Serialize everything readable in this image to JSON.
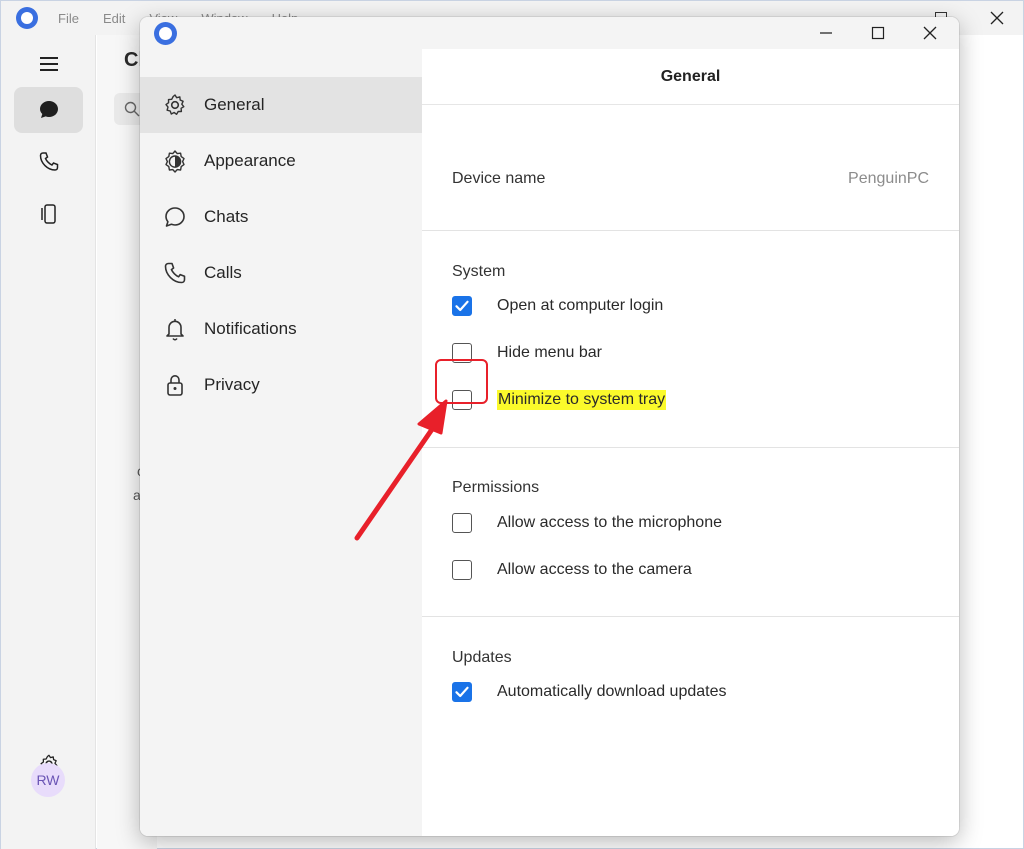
{
  "background_app": {
    "menu": [
      "File",
      "Edit",
      "View",
      "Window",
      "Help"
    ],
    "heading_fragment": "Cl",
    "side_fragments": [
      "c",
      "a"
    ],
    "avatar_initials": "RW",
    "rail_icons": [
      "menu-icon",
      "chat-icon",
      "phone-icon",
      "device-icon",
      "settings-icon"
    ]
  },
  "dialog": {
    "title_bar": {
      "icon": "app-logo-icon",
      "controls": [
        "minimize",
        "maximize",
        "close"
      ]
    },
    "sidebar": {
      "items": [
        {
          "label": "General",
          "icon": "gear-icon",
          "active": true
        },
        {
          "label": "Appearance",
          "icon": "appearance-icon",
          "active": false
        },
        {
          "label": "Chats",
          "icon": "chat-bubble-icon",
          "active": false
        },
        {
          "label": "Calls",
          "icon": "phone-icon",
          "active": false
        },
        {
          "label": "Notifications",
          "icon": "bell-icon",
          "active": false
        },
        {
          "label": "Privacy",
          "icon": "lock-icon",
          "active": false
        }
      ]
    },
    "content": {
      "title": "General",
      "device": {
        "label": "Device name",
        "value": "PenguinPC"
      },
      "system": {
        "title": "System",
        "options": [
          {
            "label": "Open at computer login",
            "checked": true
          },
          {
            "label": "Hide menu bar",
            "checked": false
          },
          {
            "label": "Minimize to system tray",
            "checked": false,
            "highlighted": true
          }
        ]
      },
      "permissions": {
        "title": "Permissions",
        "options": [
          {
            "label": "Allow access to the microphone",
            "checked": false
          },
          {
            "label": "Allow access to the camera",
            "checked": false
          }
        ]
      },
      "updates": {
        "title": "Updates",
        "options": [
          {
            "label": "Automatically download updates",
            "checked": true
          }
        ]
      }
    }
  },
  "colors": {
    "accent": "#1a73e8",
    "highlight": "#fbfa2b",
    "annotation": "#e8202a",
    "sidebar_bg": "#f4f4f4",
    "active_item_bg": "#e3e3e3"
  }
}
